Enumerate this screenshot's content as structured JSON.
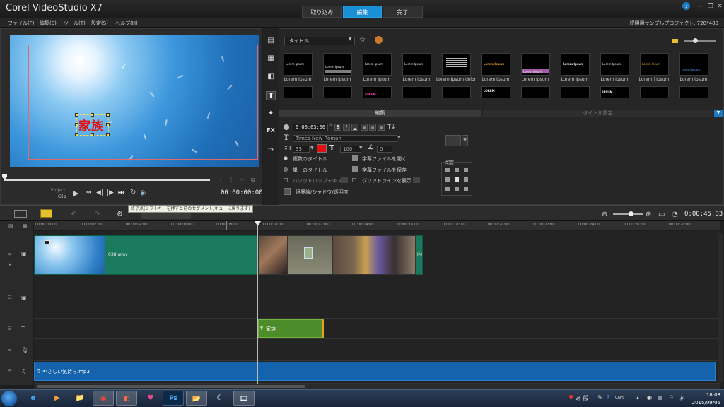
{
  "window": {
    "title": "Corel VideoStudio X7",
    "controls": [
      "?",
      "—",
      "❐",
      "✕"
    ]
  },
  "steps": [
    {
      "label": "取り込み",
      "active": false
    },
    {
      "label": "編集",
      "active": true
    },
    {
      "label": "完了",
      "active": false
    }
  ],
  "menu": [
    "ファイル(F)",
    "編集(E)",
    "ツール(T)",
    "設定(S)",
    "ヘルプ(H)"
  ],
  "project_info": "説明用サンプルプロジェクト, 720*480",
  "preview": {
    "overlay_title": "家族",
    "modes": {
      "project": "Project",
      "clip": "Clip"
    },
    "timecode": "00:00:00:00"
  },
  "library": {
    "category": "タイトル",
    "thumbnails": [
      {
        "text": "Lorem Ipsum",
        "label": "Lorem Ipsum"
      },
      {
        "text": "Lorem Ipsum",
        "label": "Lorem Ipsum"
      },
      {
        "text": "Lorem Ipsum",
        "label": "Lorem Ipsum"
      },
      {
        "text": "Lorem Ipsum",
        "label": "Lorem Ipsum"
      },
      {
        "text": "",
        "label": "Lorem Ipsum dolor si..."
      },
      {
        "text": "Lorem Ipsum",
        "label": "Lorem Ipsum"
      },
      {
        "text": "Lorem Ipsum",
        "label": "Lorem Ipsum"
      },
      {
        "text": "Lorem Ipsum",
        "label": "Lorem Ipsum"
      },
      {
        "text": "Lorem Ipsum",
        "label": "Lorem Ipsum"
      },
      {
        "text": "Lorem Ipsum",
        "label": "Lorem | Ipsum"
      },
      {
        "text": "Lorem Ipsum",
        "label": "Lorem Ipsum"
      }
    ],
    "row2_texts": [
      "",
      "",
      "LOREM",
      "",
      "",
      "LOREM",
      "",
      "IPSUM",
      "",
      "",
      ""
    ]
  },
  "options": {
    "tab_edit": "編集",
    "tab_title_settings": "タイトル設定",
    "duration": "0:00:03:00",
    "format_buttons": [
      "B",
      "I",
      "U"
    ],
    "font": "Times New Roman",
    "font_size": "35",
    "text_color": "#e31111",
    "line_spacing": "100",
    "angle": "0",
    "multi_title": "複数のタイトル",
    "single_title": "単一のタイトル",
    "backdrop": "バックドロップテキスト",
    "open_subtitle": "字幕ファイルを開く",
    "save_subtitle": "字幕ファイルを保存",
    "show_grid": "グリッドラインを表示",
    "border_shadow": "境界線/シャドウ/透明度",
    "align_label": "配置"
  },
  "timeline": {
    "tooltip": "終了点(シフトキーを押すと前のセグメント/キューに戻ります)",
    "timecode": "0:00:45:03",
    "ruler": [
      "00:00:00:00",
      "00:00:02:00",
      "00:00:04:00",
      "00:00:06:00",
      "00:00:08:00",
      "00:00:10:00",
      "00:00:12:00",
      "00:00:14:00",
      "00:00:16:00",
      "00:00:18:00",
      "00:00:20:00",
      "00:00:22:00",
      "00:00:24:00",
      "00:00:26:00",
      "00:00:28:00"
    ],
    "video_clip_name": "038.wmv",
    "photo_clip_suffix": "IM",
    "title_clip_name": "家族",
    "music_clip_name": "やさしい気持ち.mp3"
  },
  "taskbar": {
    "time": "18:08",
    "date": "2015/09/05",
    "apps": [
      "e",
      "▶",
      "📁",
      "◉",
      "◐",
      "♥",
      "Ps",
      "📂",
      "☾",
      "🎞"
    ],
    "tray_ime": "あ 般"
  }
}
